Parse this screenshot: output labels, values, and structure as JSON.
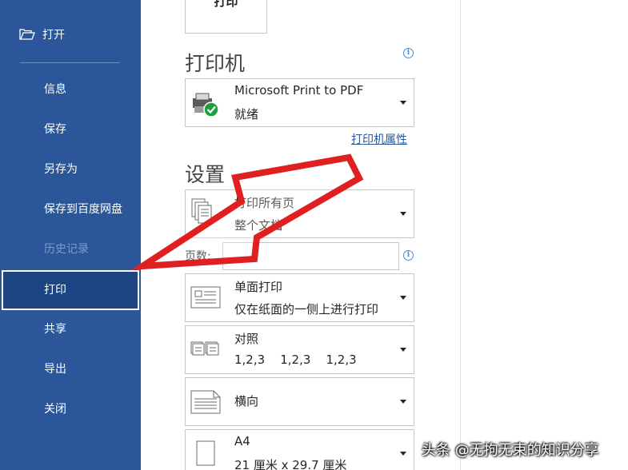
{
  "sidebar": {
    "open_label": "打开",
    "items": [
      {
        "label": "信息"
      },
      {
        "label": "保存"
      },
      {
        "label": "另存为"
      },
      {
        "label": "保存到百度网盘"
      },
      {
        "label": "历史记录"
      },
      {
        "label": "打印"
      },
      {
        "label": "共享"
      },
      {
        "label": "导出"
      },
      {
        "label": "关闭"
      }
    ],
    "active_item": "打印"
  },
  "print_button": {
    "label": "打印"
  },
  "printer": {
    "section_title": "打印机",
    "name": "Microsoft Print to PDF",
    "status": "就绪",
    "properties_link": "打印机属性"
  },
  "settings": {
    "section_title": "设置",
    "print_range": {
      "line1": "打印所有页",
      "line2": "整个文档"
    },
    "pages_label": "页数:",
    "pages_value": "",
    "sides": {
      "line1": "单面打印",
      "line2": "仅在纸面的一侧上进行打印"
    },
    "collate": {
      "line1": "对照",
      "line2": "1,2,3    1,2,3    1,2,3"
    },
    "orientation": {
      "line1": "横向"
    },
    "paper": {
      "line1": "A4",
      "line2": "21 厘米 x 29.7 厘米"
    }
  },
  "watermark": "头条 @无拘无束的知识分享",
  "colors": {
    "sidebar": "#2b579a",
    "active": "#1e4583",
    "arrow": "#e02020",
    "link": "#2b579a"
  }
}
